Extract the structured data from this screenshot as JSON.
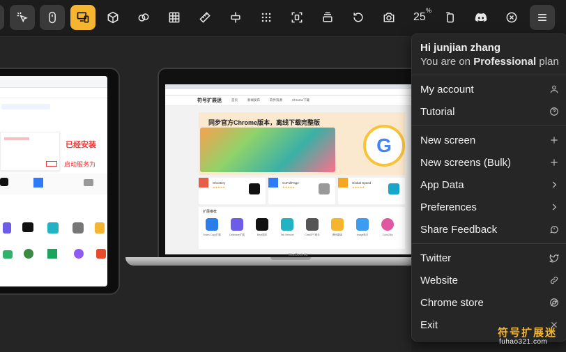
{
  "toolbar": {
    "icons": [
      "pointer-icon",
      "mouse-icon",
      "device-switch-icon",
      "cube-icon",
      "overlap-icon",
      "grid-icon",
      "ruler-icon",
      "align-icon",
      "dots-grid-icon",
      "focus-icon",
      "layers-icon",
      "rotate-icon",
      "camera-icon",
      "rotate-device-icon",
      "discord-icon",
      "close-circle-icon",
      "menu-icon"
    ],
    "zoom_value": "25",
    "zoom_unit": "%",
    "accent_color": "#f5b52e"
  },
  "menu": {
    "greeting": "Hi junjian zhang",
    "plan_prefix": "You are on ",
    "plan_name": "Professional",
    "plan_suffix": " plan",
    "sections": [
      [
        {
          "label": "My account",
          "icon": "user-icon"
        },
        {
          "label": "Tutorial",
          "icon": "help-circle-icon"
        }
      ],
      [
        {
          "label": "New screen",
          "icon": "plus-icon"
        },
        {
          "label": "New screens (Bulk)",
          "icon": "plus-icon"
        },
        {
          "label": "App Data",
          "icon": "chevron-right-icon"
        },
        {
          "label": "Preferences",
          "icon": "chevron-right-icon"
        },
        {
          "label": "Share Feedback",
          "icon": "feedback-icon"
        }
      ],
      [
        {
          "label": "Twitter",
          "icon": "twitter-icon"
        },
        {
          "label": "Website",
          "icon": "link-icon"
        },
        {
          "label": "Chrome store",
          "icon": "chrome-icon"
        },
        {
          "label": "Exit",
          "icon": "close-icon"
        }
      ]
    ]
  },
  "laptop": {
    "base_label": "MacBook Air",
    "site": {
      "logo": "符号扩展迷",
      "nav": [
        "首页",
        "新闻发布",
        "软件资源",
        "Chrome下载"
      ],
      "banner_title": "同步官方Chrome版本，离线下载完整版",
      "cards": [
        "Ghostery",
        "GoFullPage",
        "Global Speed"
      ],
      "rating": "★★★★★",
      "grid_title": "扩展推荐",
      "grid_items": [
        "Smart Copy扩展",
        "Dashlane扩展",
        "Bear插件",
        "Tab Session",
        "ChatGPT助手",
        "腾讯翻译",
        "Image助手",
        "ColorZilla"
      ]
    }
  },
  "tablet": {
    "red_text": "已经安装",
    "red_text2": "启动服务为"
  },
  "watermark": {
    "cn": "符号扩展迷",
    "url": "fuhao321.com"
  }
}
